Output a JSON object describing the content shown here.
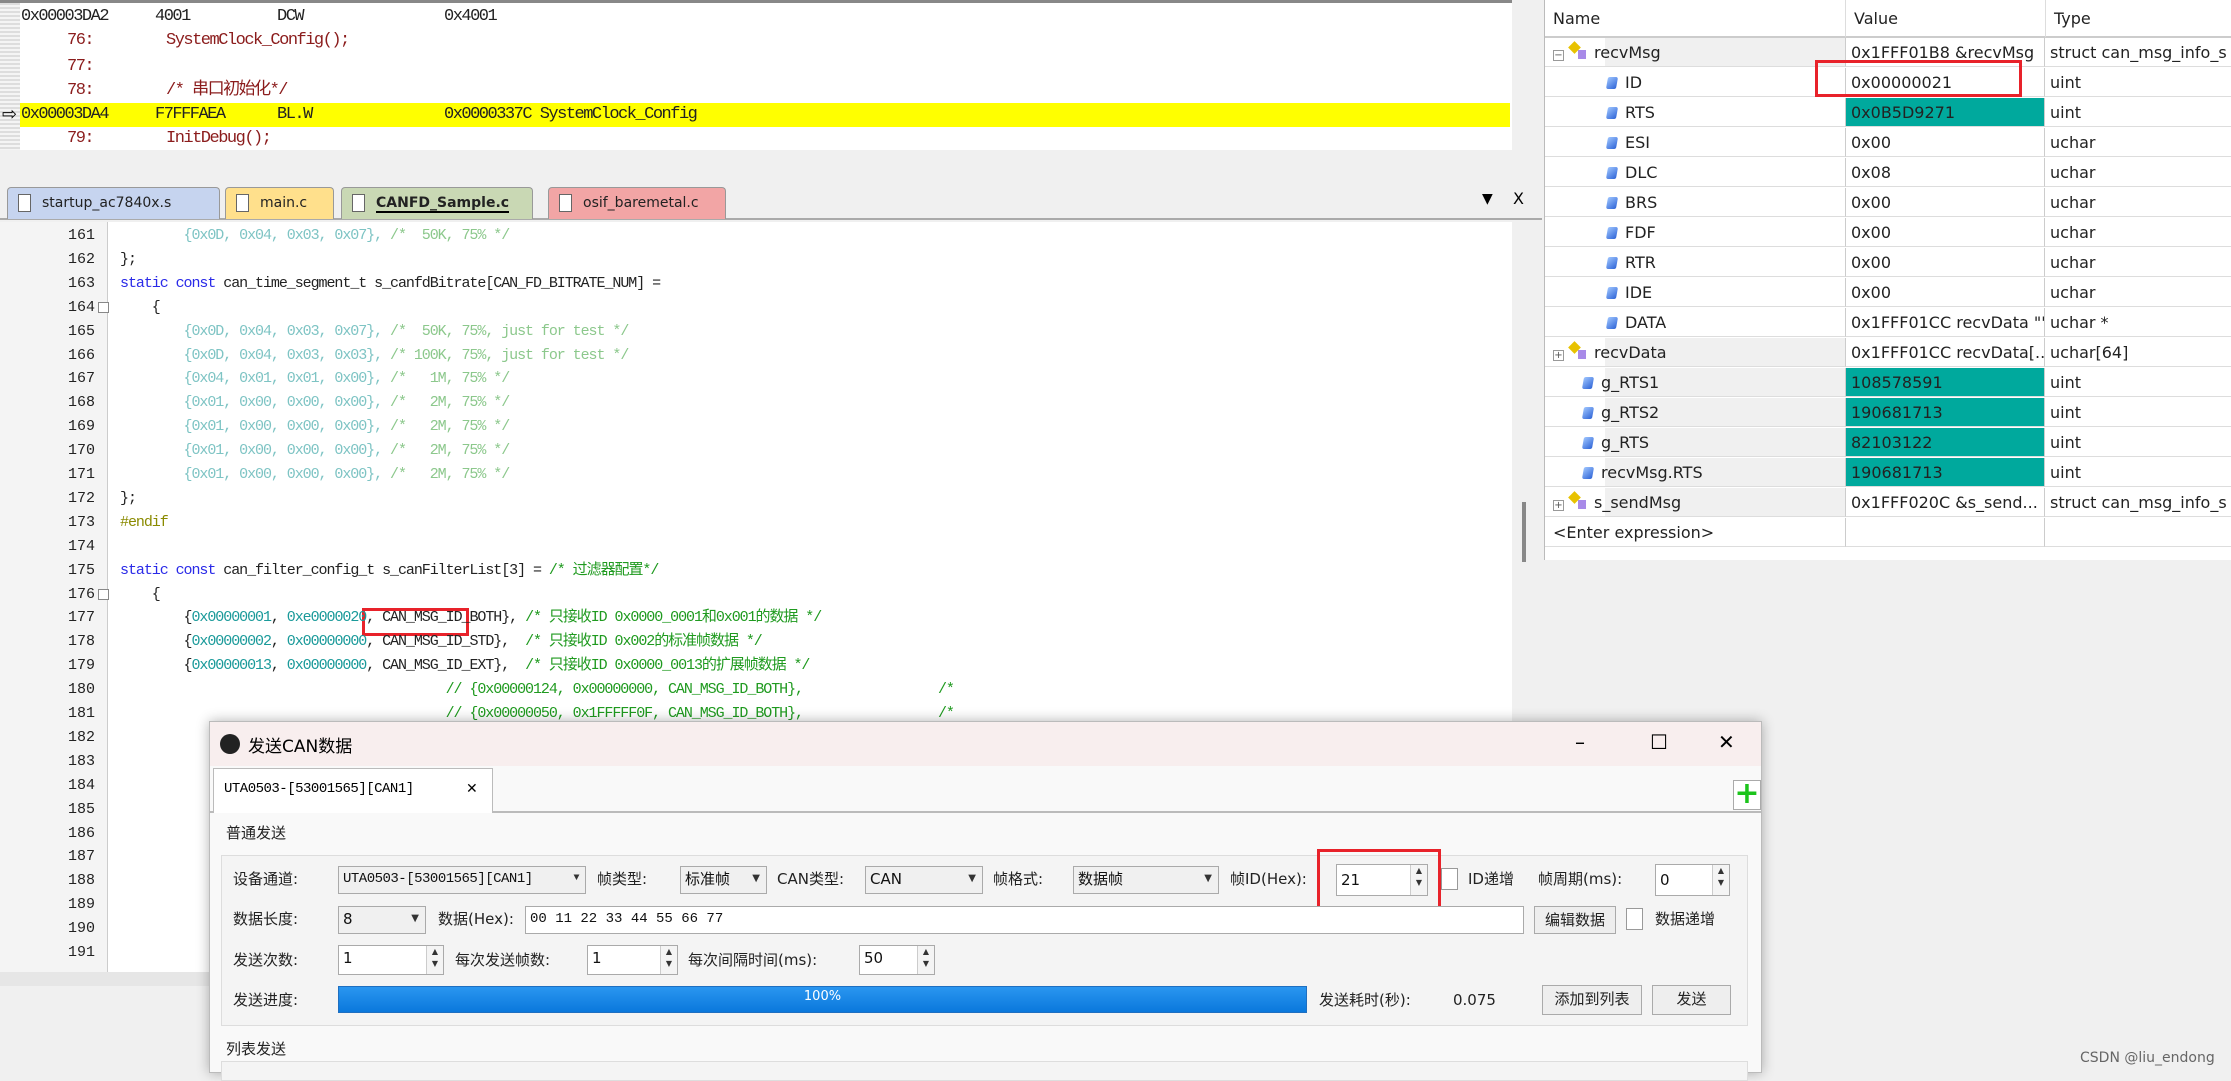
{
  "disassembly": {
    "lines": [
      {
        "addr": "0x00003DA2",
        "hex": "4001",
        "op": "DCW",
        "arg": "0x4001",
        "src": false
      },
      {
        "num": "76:",
        "code": "SystemClock_Config();",
        "src": true
      },
      {
        "num": "77:",
        "code": "",
        "src": true
      },
      {
        "num": "78:",
        "code": "/* 串口初始化*/",
        "src": true
      },
      {
        "addr": "0x00003DA4",
        "hex": "F7FFFAEA",
        "op": "BL.W",
        "arg": "0x0000337C SystemClock_Config",
        "src": false,
        "current": true
      },
      {
        "num": "79:",
        "code": "InitDebug();",
        "src": true
      }
    ],
    "highlight_color": "#ffff00"
  },
  "tabs": [
    {
      "label": "startup_ac7840x.s",
      "color": "#c6d4ef"
    },
    {
      "label": "main.c",
      "color": "#ffe08c"
    },
    {
      "label": "CANFD_Sample.c",
      "color": "#c9d8b4",
      "active": true
    },
    {
      "label": "osif_baremetal.c",
      "color": "#f2a5a5"
    }
  ],
  "tab_controls": {
    "menu": "▼",
    "close": "X"
  },
  "code": [
    {
      "n": "161",
      "segs": [
        [
          "fh",
          "        {0x0D, 0x04, 0x03, 0x07}, "
        ],
        [
          "fc",
          "/*  50K, 75% */"
        ]
      ]
    },
    {
      "n": "162",
      "segs": [
        [
          "pl",
          "};"
        ]
      ]
    },
    {
      "n": "163",
      "segs": [
        [
          "kw",
          "static const "
        ],
        [
          "pl",
          "can_time_segment_t s_canfdBitrate[CAN_FD_BITRATE_NUM] ="
        ]
      ]
    },
    {
      "n": "164",
      "segs": [
        [
          "pl",
          "    {"
        ]
      ]
    },
    {
      "n": "165",
      "segs": [
        [
          "fh",
          "        {0x0D, 0x04, 0x03, 0x07}, "
        ],
        [
          "fc",
          "/*  50K, 75%, just for test */"
        ]
      ]
    },
    {
      "n": "166",
      "segs": [
        [
          "fh",
          "        {0x0D, 0x04, 0x03, 0x03}, "
        ],
        [
          "fc",
          "/* 100K, 75%, just for test */"
        ]
      ]
    },
    {
      "n": "167",
      "segs": [
        [
          "fh",
          "        {0x04, 0x01, 0x01, 0x00}, "
        ],
        [
          "fc",
          "/*   1M, 75% */"
        ]
      ]
    },
    {
      "n": "168",
      "segs": [
        [
          "fh",
          "        {0x01, 0x00, 0x00, 0x00}, "
        ],
        [
          "fc",
          "/*   2M, 75% */"
        ]
      ]
    },
    {
      "n": "169",
      "segs": [
        [
          "fh",
          "        {0x01, 0x00, 0x00, 0x00}, "
        ],
        [
          "fc",
          "/*   2M, 75% */"
        ]
      ]
    },
    {
      "n": "170",
      "segs": [
        [
          "fh",
          "        {0x01, 0x00, 0x00, 0x00}, "
        ],
        [
          "fc",
          "/*   2M, 75% */"
        ]
      ]
    },
    {
      "n": "171",
      "segs": [
        [
          "fh",
          "        {0x01, 0x00, 0x00, 0x00}, "
        ],
        [
          "fc",
          "/*   2M, 75% */"
        ]
      ]
    },
    {
      "n": "172",
      "segs": [
        [
          "pl",
          "};"
        ]
      ]
    },
    {
      "n": "173",
      "segs": [
        [
          "pp",
          "#endif"
        ]
      ]
    },
    {
      "n": "174",
      "segs": []
    },
    {
      "n": "175",
      "segs": [
        [
          "kw",
          "static const "
        ],
        [
          "pl",
          "can_filter_config_t s_canFilterList[3] = "
        ],
        [
          "cm",
          "/* 过滤器配置*/"
        ]
      ]
    },
    {
      "n": "176",
      "segs": [
        [
          "pl",
          "    {"
        ]
      ]
    },
    {
      "n": "177",
      "segs": [
        [
          "pl",
          "        {"
        ],
        [
          "hx",
          "0x00000001"
        ],
        [
          "pl",
          ", "
        ],
        [
          "hx",
          "0xe0000020"
        ],
        [
          "pl",
          ", CAN_MSG_ID_BOTH}, "
        ],
        [
          "cm",
          "/* 只接收ID 0x0000_0001和0x001的数据 */"
        ]
      ]
    },
    {
      "n": "178",
      "segs": [
        [
          "pl",
          "        {"
        ],
        [
          "hx",
          "0x00000002"
        ],
        [
          "pl",
          ", "
        ],
        [
          "hx",
          "0x00000000"
        ],
        [
          "pl",
          ", CAN_MSG_ID_STD},  "
        ],
        [
          "cm",
          "/* 只接收ID 0x002的标准帧数据 */"
        ]
      ]
    },
    {
      "n": "179",
      "segs": [
        [
          "pl",
          "        {"
        ],
        [
          "hx",
          "0x00000013"
        ],
        [
          "pl",
          ", "
        ],
        [
          "hx",
          "0x00000000"
        ],
        [
          "pl",
          ", CAN_MSG_ID_EXT},  "
        ],
        [
          "cm",
          "/* 只接收ID 0x0000_0013的扩展帧数据 */"
        ]
      ]
    },
    {
      "n": "180",
      "segs": [
        [
          "cm",
          "                                         // {0x00000124, 0x00000000, CAN_MSG_ID_BOTH},                 /*"
        ]
      ]
    },
    {
      "n": "181",
      "segs": [
        [
          "cm",
          "                                         // {0x00000050, 0x1FFFFF0F, CAN_MSG_ID_BOTH},                 /*"
        ]
      ]
    },
    {
      "n": "182",
      "segs": []
    },
    {
      "n": "183",
      "segs": []
    },
    {
      "n": "184",
      "segs": []
    },
    {
      "n": "185",
      "segs": []
    },
    {
      "n": "186",
      "segs": []
    },
    {
      "n": "187",
      "segs": []
    },
    {
      "n": "188",
      "segs": []
    },
    {
      "n": "189",
      "segs": []
    },
    {
      "n": "190",
      "segs": []
    },
    {
      "n": "191",
      "segs": []
    }
  ],
  "watch": {
    "headers": [
      "Name",
      "Value",
      "Type"
    ],
    "rows": [
      {
        "name": "recvMsg",
        "value": "0x1FFF01B8 &recvMsg",
        "type": "struct can_msg_info_s",
        "level": 0,
        "kind": "struct",
        "expander": "-"
      },
      {
        "name": "ID",
        "value": "0x00000021",
        "type": "uint",
        "level": 1,
        "kind": "var"
      },
      {
        "name": "RTS",
        "value": "0x0B5D9271",
        "type": "uint",
        "level": 1,
        "kind": "var",
        "changed": true
      },
      {
        "name": "ESI",
        "value": "0x00",
        "type": "uchar",
        "level": 1,
        "kind": "var"
      },
      {
        "name": "DLC",
        "value": "0x08",
        "type": "uchar",
        "level": 1,
        "kind": "var"
      },
      {
        "name": "BRS",
        "value": "0x00",
        "type": "uchar",
        "level": 1,
        "kind": "var"
      },
      {
        "name": "FDF",
        "value": "0x00",
        "type": "uchar",
        "level": 1,
        "kind": "var"
      },
      {
        "name": "RTR",
        "value": "0x00",
        "type": "uchar",
        "level": 1,
        "kind": "var"
      },
      {
        "name": "IDE",
        "value": "0x00",
        "type": "uchar",
        "level": 1,
        "kind": "var"
      },
      {
        "name": "DATA",
        "value": "0x1FFF01CC recvData \"\"",
        "type": "uchar *",
        "level": 1,
        "kind": "var"
      },
      {
        "name": "recvData",
        "value": "0x1FFF01CC recvData[...",
        "type": "uchar[64]",
        "level": 0,
        "kind": "struct",
        "expander": "+"
      },
      {
        "name": "g_RTS1",
        "value": "108578591",
        "type": "uint",
        "level": 0,
        "kind": "var",
        "changed": true
      },
      {
        "name": "g_RTS2",
        "value": "190681713",
        "type": "uint",
        "level": 0,
        "kind": "var",
        "changed": true
      },
      {
        "name": "g_RTS",
        "value": "82103122",
        "type": "uint",
        "level": 0,
        "kind": "var",
        "changed": true
      },
      {
        "name": "recvMsg.RTS",
        "value": "190681713",
        "type": "uint",
        "level": 0,
        "kind": "var",
        "changed": true
      },
      {
        "name": "s_sendMsg",
        "value": "0x1FFF020C &s_send...",
        "type": "struct can_msg_info_s",
        "level": 0,
        "kind": "struct",
        "expander": "+"
      },
      {
        "name": "<Enter expression>",
        "value": "",
        "type": "",
        "level": 0,
        "kind": "none"
      }
    ],
    "changed_color": "#00a99d"
  },
  "dialog": {
    "title": "发送CAN数据",
    "controls": {
      "minimize": "–",
      "maximize": "☐",
      "close": "✕"
    },
    "tab": "UTA0503-[53001565][CAN1]",
    "tab_close": "✕",
    "add_tab": "+",
    "section_normal": "普通发送",
    "section_list": "列表发送",
    "device_label": "设备通道:",
    "device_value": "UTA0503-[53001565][CAN1]",
    "frame_type_label": "帧类型:",
    "frame_type_value": "标准帧",
    "can_type_label": "CAN类型:",
    "can_type_value": "CAN",
    "frame_format_label": "帧格式:",
    "frame_format_value": "数据帧",
    "frame_id_label": "帧ID(Hex):",
    "frame_id_value": "21",
    "id_inc_label": "ID递增",
    "period_label": "帧周期(ms):",
    "period_value": "0",
    "dlc_label": "数据长度:",
    "dlc_value": "8",
    "data_label": "数据(Hex):",
    "data_value": "00 11 22 33 44 55 66 77",
    "edit_data": "编辑数据",
    "data_inc_label": "数据递增",
    "count_label": "发送次数:",
    "count_value": "1",
    "frames_label": "每次发送帧数:",
    "frames_value": "1",
    "interval_label": "每次间隔时间(ms):",
    "interval_value": "50",
    "progress_label": "发送进度:",
    "progress_text": "100%",
    "progress": 100,
    "elapsed_label": "发送耗时(秒):",
    "elapsed_value": "0.075",
    "add_to_list": "添加到列表",
    "send": "发送"
  },
  "watermark": "CSDN @liu_endong"
}
